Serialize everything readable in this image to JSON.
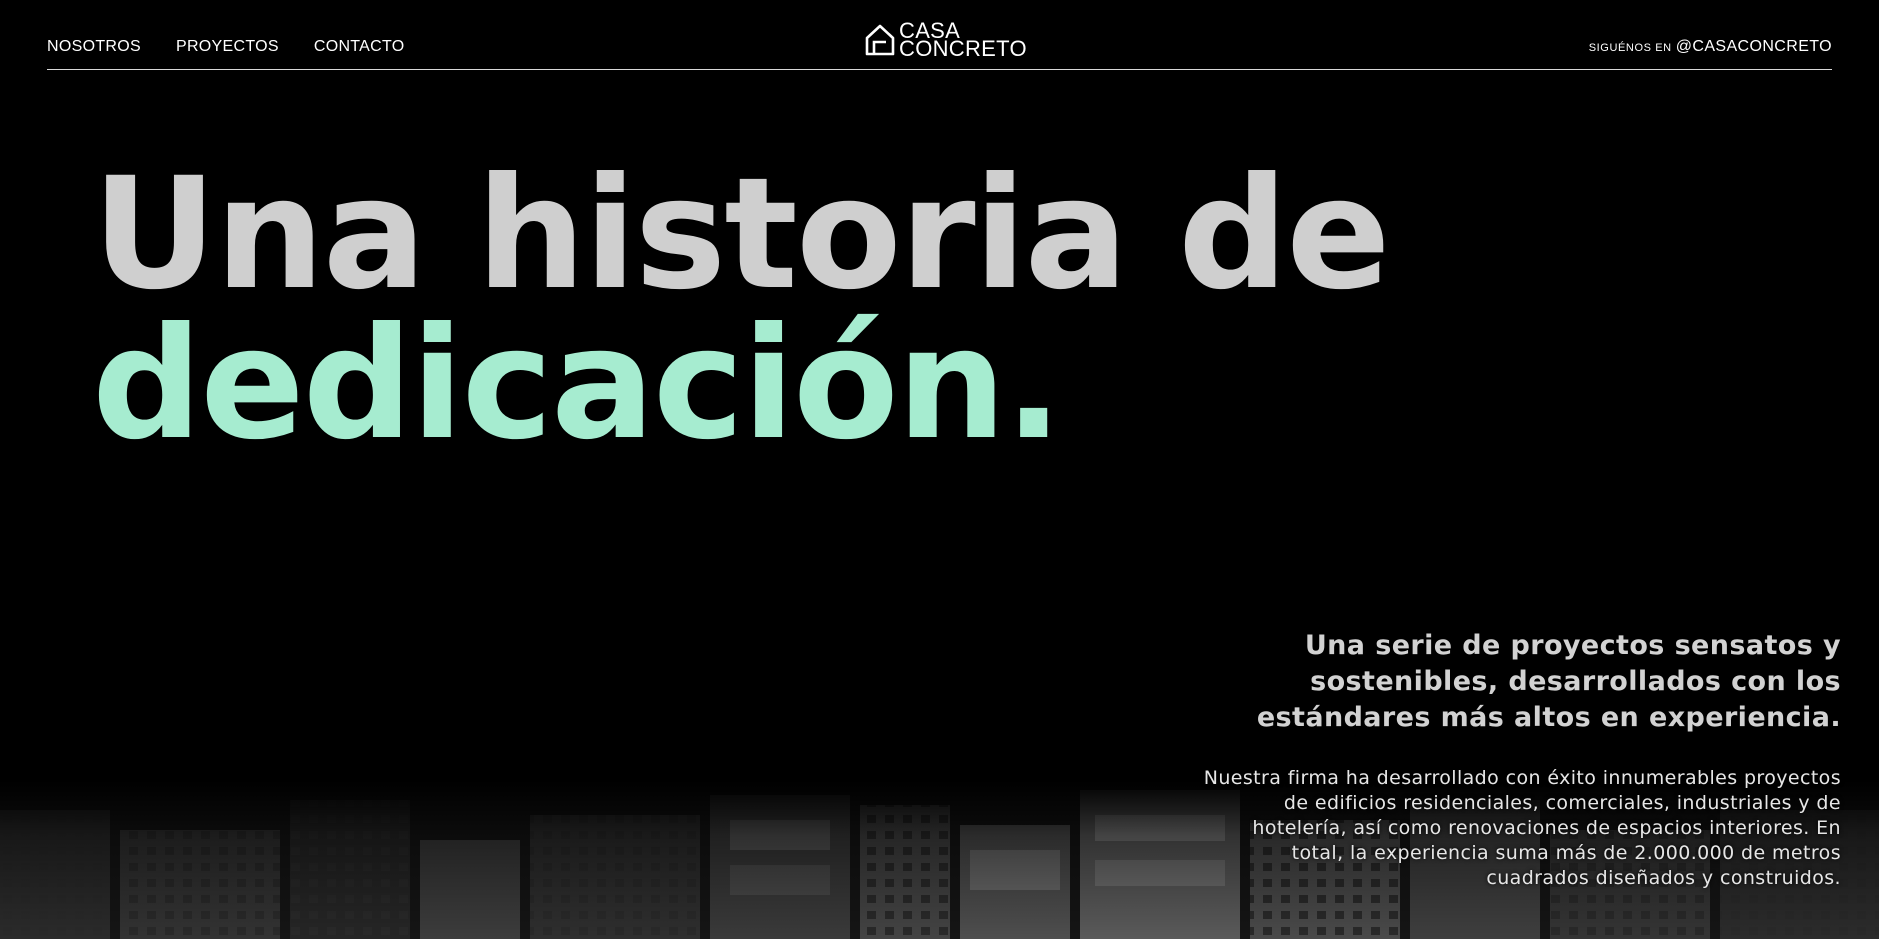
{
  "header": {
    "nav": [
      {
        "label": "NOSOTROS"
      },
      {
        "label": "PROYECTOS"
      },
      {
        "label": "CONTACTO"
      }
    ],
    "logo": {
      "line1": "CASA",
      "line2": "CONCRETO",
      "icon": "house-icon"
    },
    "social": {
      "prefix": "SIGUÉNOS EN",
      "handle": "@CASACONCRETO"
    }
  },
  "hero": {
    "line1": "Una historia de",
    "line2": "dedicación.",
    "accent_color": "#a6ecd0",
    "text_color": "#cfcfcf"
  },
  "intro": {
    "lead": "Una serie de proyectos sensatos y sostenibles, desarrollados con los estándares más altos en experiencia.",
    "body": "Nuestra firma ha desarrollado con éxito innumerables proyectos de edificios residenciales, comerciales, industriales y de hotelería, así como renovaciones de espacios interiores. En total, la experiencia suma más de 2.000.000 de metros cuadrados diseñados y construidos."
  },
  "background": {
    "image": "city-buildings-photo"
  }
}
